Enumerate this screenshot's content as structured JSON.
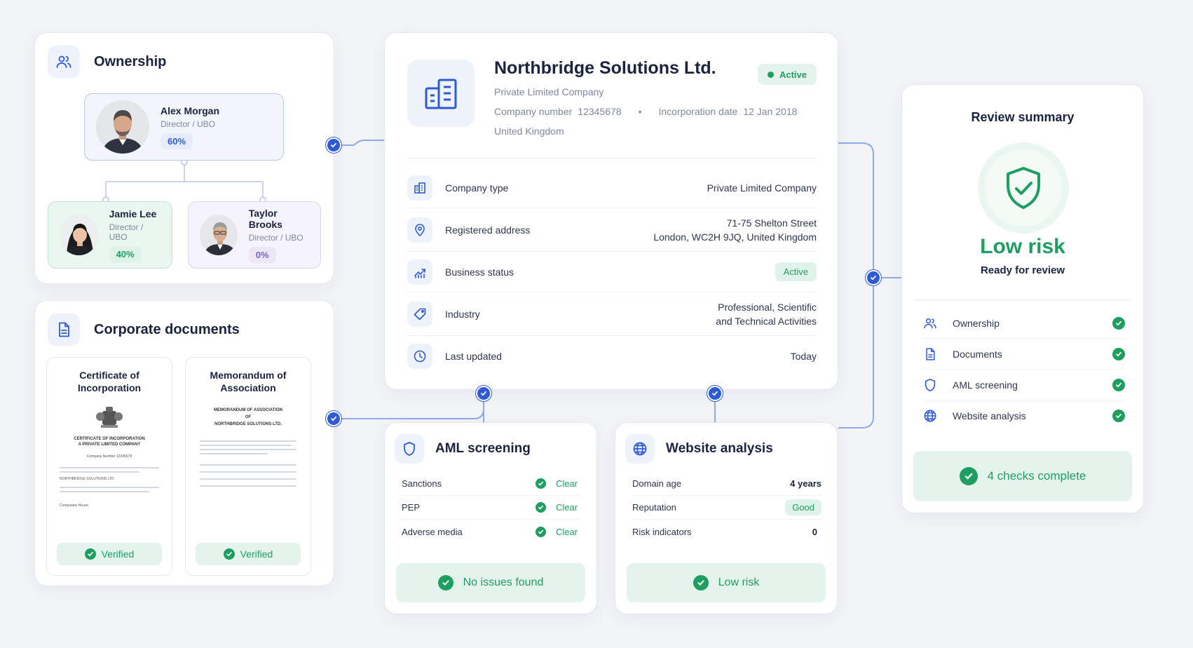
{
  "ownership": {
    "title": "Ownership",
    "owners": [
      {
        "name": "Alex Morgan",
        "role": "Director / UBO",
        "share": "60%"
      },
      {
        "name": "Jamie Lee",
        "role": "Director / UBO",
        "share": "40%"
      },
      {
        "name": "Taylor Brooks",
        "role": "Director / UBO",
        "share": "0%"
      }
    ]
  },
  "documents": {
    "title": "Corporate documents",
    "items": [
      {
        "title": "Certificate of Incorporation",
        "heading_lines": [
          "CERTIFICATE OF INCORPORATION",
          "A PRIVATE LIMITED COMPANY"
        ],
        "company_number_text": "Company Number 12345678",
        "company_line": "NORTHBRIDGE SOLUTIONS LTD",
        "footer": "Companies House",
        "status": "Verified"
      },
      {
        "title": "Memorandum of Association",
        "heading_lines": [
          "MEMORANDUM OF ASSOCIATION",
          "OF",
          "NORTHBRIDGE SOLUTIONS LTD."
        ],
        "status": "Verified"
      }
    ]
  },
  "company": {
    "name": "Northbridge Solutions Ltd.",
    "status_badge": "Active",
    "type_line": "Private Limited Company",
    "company_number_label": "Company number",
    "company_number": "12345678",
    "separator": "•",
    "incorporation_label": "Incorporation date",
    "incorporation_date": "12 Jan 2018",
    "country": "United Kingdom",
    "details": [
      {
        "icon": "building-icon",
        "label": "Company type",
        "value": "Private Limited Company"
      },
      {
        "icon": "location-pin-icon",
        "label": "Registered address",
        "value_line1": "71-75 Shelton Street",
        "value_line2": "London, WC2H 9JQ, United Kingdom"
      },
      {
        "icon": "trend-chart-icon",
        "label": "Business status",
        "value": "Active"
      },
      {
        "icon": "tag-icon",
        "label": "Industry",
        "value_line1": "Professional, Scientific",
        "value_line2": "and Technical Activities"
      },
      {
        "icon": "clock-icon",
        "label": "Last updated",
        "value": "Today"
      }
    ]
  },
  "aml": {
    "title": "AML screening",
    "rows": [
      {
        "label": "Sanctions",
        "value": "Clear"
      },
      {
        "label": "PEP",
        "value": "Clear"
      },
      {
        "label": "Adverse media",
        "value": "Clear"
      }
    ],
    "banner": "No issues found"
  },
  "website": {
    "title": "Website analysis",
    "rows": [
      {
        "label": "Domain age",
        "value": "4 years"
      },
      {
        "label": "Reputation",
        "value": "Good"
      },
      {
        "label": "Risk indicators",
        "value": "0"
      }
    ],
    "banner": "Low risk"
  },
  "summary": {
    "title": "Review summary",
    "risk_label": "Low risk",
    "risk_sub": "Ready for review",
    "items": [
      {
        "icon": "people-icon",
        "label": "Ownership"
      },
      {
        "icon": "document-icon",
        "label": "Documents"
      },
      {
        "icon": "shield-icon",
        "label": "AML screening"
      },
      {
        "icon": "globe-icon",
        "label": "Website analysis"
      }
    ],
    "banner": "4 checks complete"
  },
  "colors": {
    "accent": "#2f5ad6",
    "success": "#1e9e61",
    "success_bg": "#e4f4ec",
    "background": "#f2f4f7"
  }
}
